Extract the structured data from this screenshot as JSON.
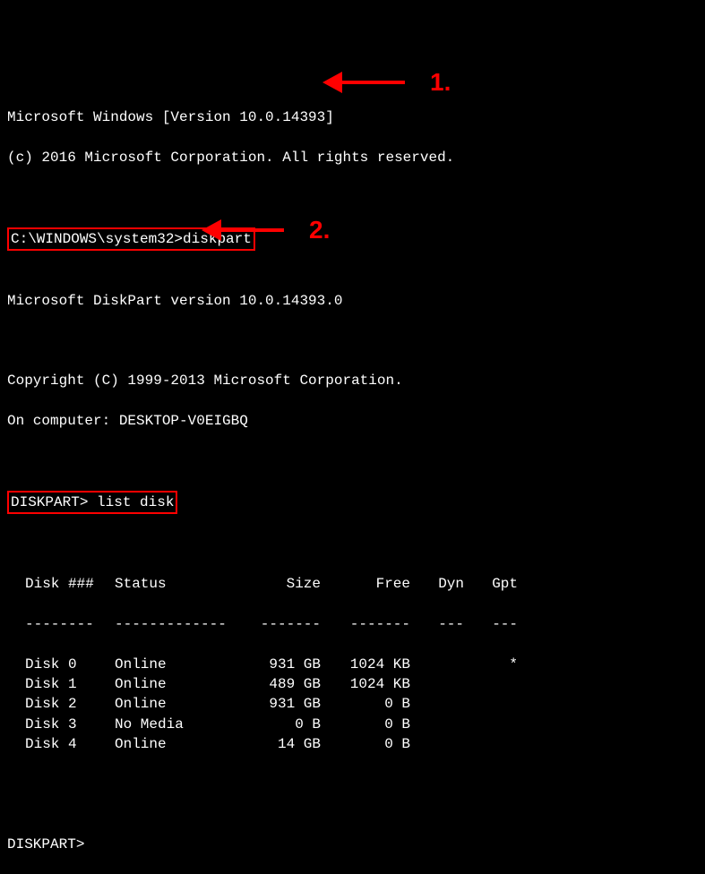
{
  "header": {
    "line1": "Microsoft Windows [Version 10.0.14393]",
    "line2": "(c) 2016 Microsoft Corporation. All rights reserved."
  },
  "cmd1": {
    "prompt": "C:\\WINDOWS\\system32>",
    "command": "diskpart",
    "annotation_label": "1."
  },
  "diskpart": {
    "version_line": "Microsoft DiskPart version 10.0.14393.0",
    "copyright_line": "Copyright (C) 1999-2013 Microsoft Corporation.",
    "computer_line": "On computer: DESKTOP-V0EIGBQ"
  },
  "cmd2": {
    "prompt": "DISKPART> ",
    "command": "list disk",
    "annotation_label": "2."
  },
  "table": {
    "headers": {
      "disk": "Disk ###",
      "status": "Status",
      "size": "Size",
      "free": "Free",
      "dyn": "Dyn",
      "gpt": "Gpt"
    },
    "separators": {
      "disk": "--------",
      "status": "-------------",
      "size": "-------",
      "free": "-------",
      "dyn": "---",
      "gpt": "---"
    },
    "rows": [
      {
        "disk": "Disk 0",
        "status": "Online",
        "size": "931 GB",
        "free": "1024 KB",
        "dyn": "",
        "gpt": "*"
      },
      {
        "disk": "Disk 1",
        "status": "Online",
        "size": "489 GB",
        "free": "1024 KB",
        "dyn": "",
        "gpt": ""
      },
      {
        "disk": "Disk 2",
        "status": "Online",
        "size": "931 GB",
        "free": "0 B",
        "dyn": "",
        "gpt": ""
      },
      {
        "disk": "Disk 3",
        "status": "No Media",
        "size": "0 B",
        "free": "0 B",
        "dyn": "",
        "gpt": ""
      },
      {
        "disk": "Disk 4",
        "status": "Online",
        "size": "14 GB",
        "free": "0 B",
        "dyn": "",
        "gpt": ""
      }
    ]
  },
  "final_prompt": "DISKPART>",
  "colors": {
    "highlight": "#ff0000",
    "background": "#000000",
    "text": "#ffffff"
  }
}
